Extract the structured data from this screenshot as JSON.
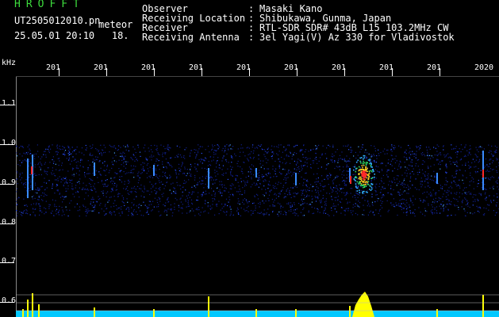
{
  "header": {
    "app_title": "HROFFT",
    "filename": "UT2505012010.pn",
    "mode": "meteor",
    "timestamp": "25.05.01 20:10",
    "extra": "18.",
    "fields": [
      {
        "label": "Observer",
        "value": "Masaki Kano"
      },
      {
        "label": "Receiving Location",
        "value": "Shibukawa, Gunma, Japan"
      },
      {
        "label": "Receiver",
        "value": "RTL-SDR SDR# 43dB L15 103.2MHz CW"
      },
      {
        "label": "Receiving Antenna",
        "value": "3el Yagi(V) Az 330 for Vladivostok"
      }
    ],
    "separator": ":"
  },
  "spectrogram": {
    "y_unit": "kHz",
    "y_ticks": [
      "1.1",
      "1.0",
      "0.9",
      "0.8",
      "0.7",
      "0.6"
    ],
    "x_ticks": [
      "201",
      "201",
      "201",
      "201",
      "201",
      "201",
      "201",
      "201",
      "201",
      "2020"
    ],
    "colors": {
      "background": "#000000",
      "signal_low": "#1a3cff",
      "signal_high": "#ff2a2a",
      "level": "#ffff00",
      "baseline": "#00c8ff"
    }
  }
}
